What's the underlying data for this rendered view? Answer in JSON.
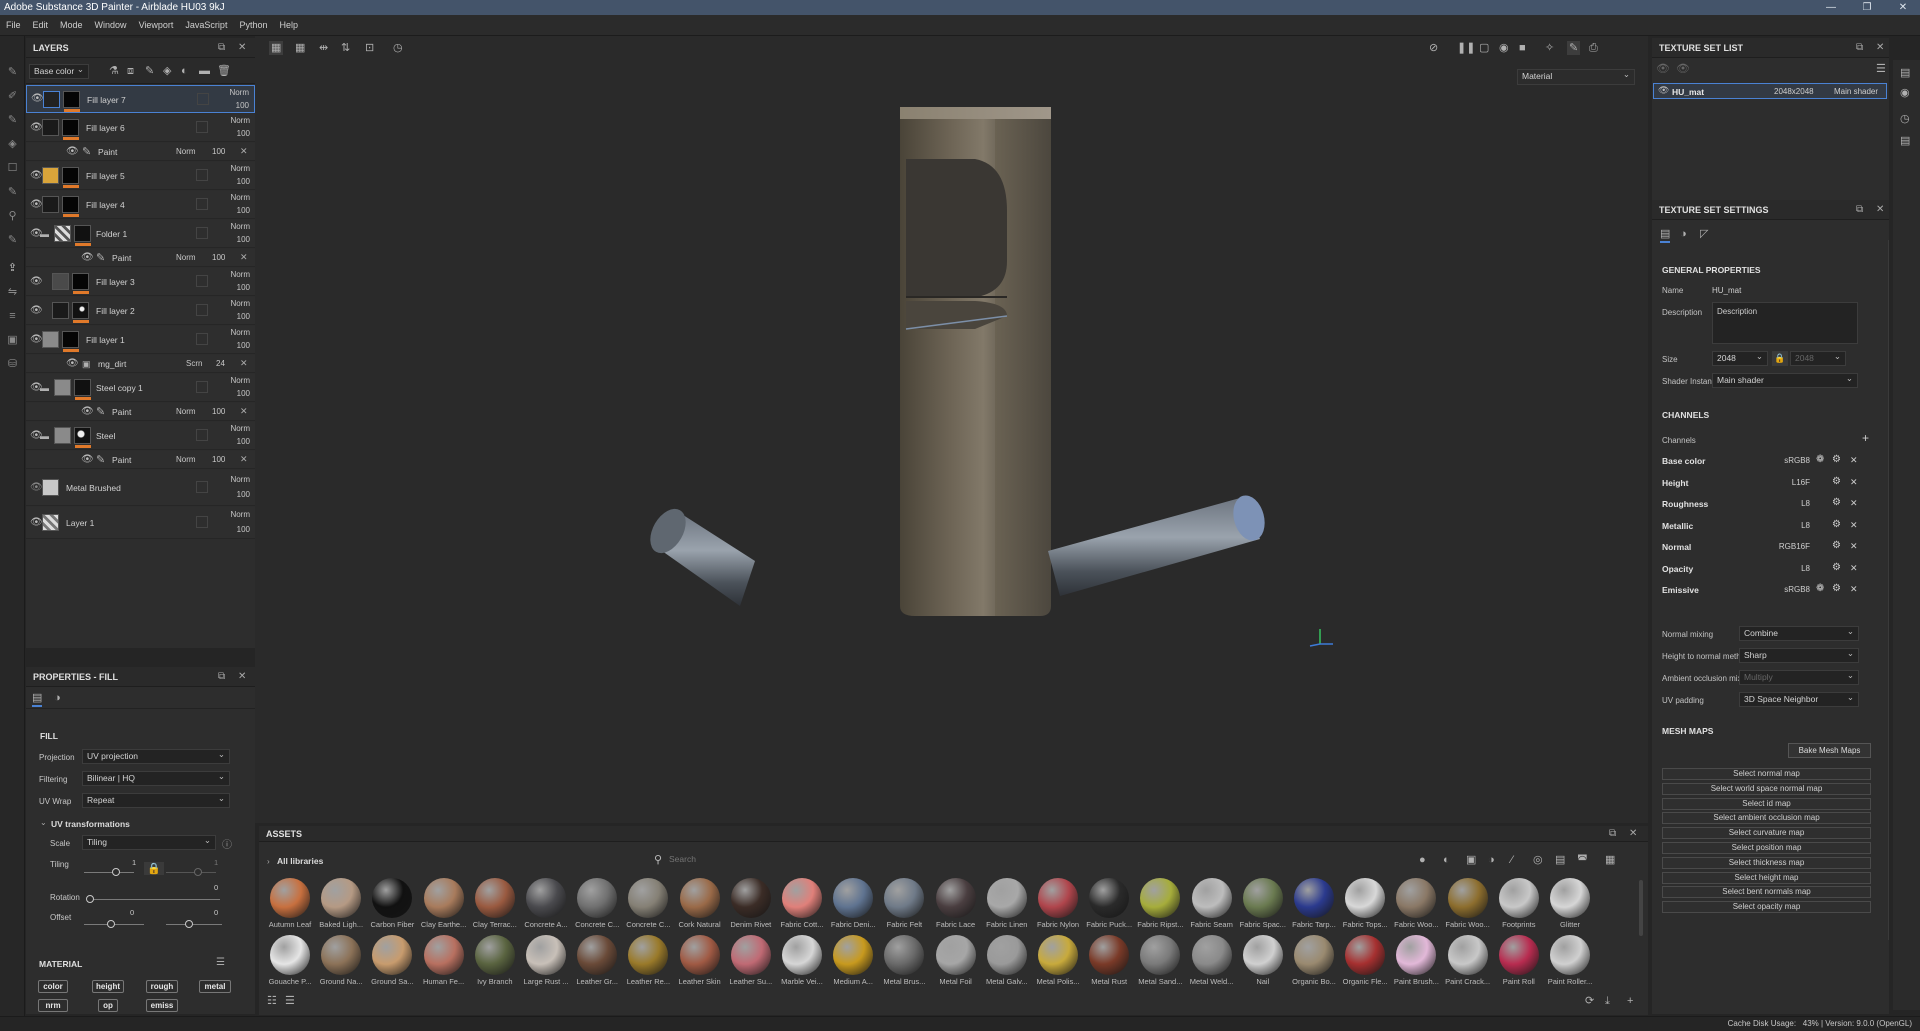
{
  "window": {
    "title": "Adobe Substance 3D Painter - Airblade HU03 9kJ"
  },
  "menu": [
    "File",
    "Edit",
    "Mode",
    "Window",
    "Viewport",
    "JavaScript",
    "Python",
    "Help"
  ],
  "layers": {
    "title": "LAYERS",
    "channel_select": "Base color",
    "rows": [
      {
        "name": "Fill layer 7",
        "blend": "Norm",
        "opacity": "100"
      },
      {
        "name": "Fill layer 6",
        "blend": "Norm",
        "opacity": "100"
      },
      {
        "name": "Paint",
        "blend": "Norm",
        "opacity": "100"
      },
      {
        "name": "Fill layer 5",
        "blend": "Norm",
        "opacity": "100"
      },
      {
        "name": "Fill layer 4",
        "blend": "Norm",
        "opacity": "100"
      },
      {
        "name": "Folder 1",
        "blend": "Norm",
        "opacity": "100"
      },
      {
        "name": "Paint",
        "blend": "Norm",
        "opacity": "100"
      },
      {
        "name": "Fill layer 3",
        "blend": "Norm",
        "opacity": "100"
      },
      {
        "name": "Fill layer 2",
        "blend": "Norm",
        "opacity": "100"
      },
      {
        "name": "Fill layer 1",
        "blend": "Norm",
        "opacity": "100"
      },
      {
        "name": "mg_dirt",
        "blend": "Scrn",
        "opacity": "24"
      },
      {
        "name": "Steel copy 1",
        "blend": "Norm",
        "opacity": "100"
      },
      {
        "name": "Paint",
        "blend": "Norm",
        "opacity": "100"
      },
      {
        "name": "Steel",
        "blend": "Norm",
        "opacity": "100"
      },
      {
        "name": "Paint",
        "blend": "Norm",
        "opacity": "100"
      },
      {
        "name": "Metal Brushed",
        "blend": "Norm",
        "opacity": "100"
      },
      {
        "name": "Layer 1",
        "blend": "Norm",
        "opacity": "100"
      }
    ]
  },
  "properties": {
    "title": "PROPERTIES - FILL",
    "section": "FILL",
    "projection_label": "Projection",
    "projection": "UV projection",
    "filtering_label": "Filtering",
    "filtering": "Bilinear | HQ",
    "uvwrap_label": "UV Wrap",
    "uvwrap": "Repeat",
    "uvt_label": "UV transformations",
    "scale_label": "Scale",
    "scale": "Tiling",
    "tiling_label": "Tiling",
    "tiling_v1": "1",
    "tiling_v2": "1",
    "rotation_label": "Rotation",
    "rotation": "0",
    "offset_label": "Offset",
    "offset_v1": "0",
    "offset_v2": "0",
    "material_title": "MATERIAL",
    "channels": [
      "color",
      "height",
      "rough",
      "metal",
      "nrm",
      "op",
      "emiss"
    ]
  },
  "viewport": {
    "mode": "Material"
  },
  "texture_set_list": {
    "title": "TEXTURE SET LIST",
    "name": "HU_mat",
    "size": "2048x2048",
    "shader": "Main shader"
  },
  "texture_set_settings": {
    "title": "TEXTURE SET SETTINGS",
    "general": "GENERAL PROPERTIES",
    "name_label": "Name",
    "name": "HU_mat",
    "desc_label": "Description",
    "desc": "Description",
    "size_label": "Size",
    "size": "2048",
    "size2": "2048",
    "shader_label": "Shader Instance",
    "shader": "Main shader",
    "channels_title": "CHANNELS",
    "channels_label": "Channels",
    "channels": [
      {
        "name": "Base color",
        "fmt": "sRGB8"
      },
      {
        "name": "Height",
        "fmt": "L16F"
      },
      {
        "name": "Roughness",
        "fmt": "L8"
      },
      {
        "name": "Metallic",
        "fmt": "L8"
      },
      {
        "name": "Normal",
        "fmt": "RGB16F"
      },
      {
        "name": "Opacity",
        "fmt": "L8"
      },
      {
        "name": "Emissive",
        "fmt": "sRGB8"
      }
    ],
    "normal_mixing_label": "Normal mixing",
    "normal_mixing": "Combine",
    "htn_label": "Height to normal method",
    "htn": "Sharp",
    "ao_label": "Ambient occlusion mixing",
    "ao": "Multiply",
    "uvpad_label": "UV padding",
    "uvpad": "3D Space Neighbor",
    "mesh_maps_title": "MESH MAPS",
    "bake": "Bake Mesh Maps",
    "maps": [
      "Select normal map",
      "Select world space normal map",
      "Select id map",
      "Select ambient occlusion map",
      "Select curvature map",
      "Select position map",
      "Select thickness map",
      "Select height map",
      "Select bent normals map",
      "Select opacity map"
    ]
  },
  "assets": {
    "title": "ASSETS",
    "library": "All libraries",
    "search_placeholder": "Search",
    "row1": [
      "Autumn Leaf",
      "Baked Ligh...",
      "Carbon Fiber",
      "Clay Earthe...",
      "Clay Terrac...",
      "Concrete A...",
      "Concrete C...",
      "Concrete C...",
      "Cork Natural",
      "Denim Rivet",
      "Fabric Cott...",
      "Fabric Deni...",
      "Fabric Felt",
      "Fabric Lace",
      "Fabric Linen",
      "Fabric Nylon",
      "Fabric Puck...",
      "Fabric Ripst...",
      "Fabric Seam",
      "Fabric Spac...",
      "Fabric Tarp...",
      "Fabric Tops...",
      "Fabric Woo...",
      "Fabric Woo...",
      "Footprints",
      "Glitter"
    ],
    "row2": [
      "Gouache P...",
      "Ground Na...",
      "Ground Sa...",
      "Human Fe...",
      "Ivy Branch",
      "Large Rust ...",
      "Leather Gr...",
      "Leather Re...",
      "Leather Skin",
      "Leather Su...",
      "Marble Vei...",
      "Medium A...",
      "Metal Brus...",
      "Metal Foil",
      "Metal Galv...",
      "Metal Polis...",
      "Metal Rust",
      "Metal Sand...",
      "Metal Weld...",
      "Nail",
      "Organic Bo...",
      "Organic Fle...",
      "Paint Brush...",
      "Paint Crack...",
      "Paint Roll",
      "Paint Roller..."
    ],
    "row1_colors": [
      "#c8703f",
      "#b59a84",
      "#111111",
      "#a87b5c",
      "#9a5a40",
      "#4a4a4e",
      "#707070",
      "#858075",
      "#9a6a48",
      "#3b2c26",
      "#e0807a",
      "#5f7390",
      "#6f7a88",
      "#4a3e40",
      "#a8a8a8",
      "#b0454c",
      "#2a2a2a",
      "#a6ad3b",
      "#bdbdbd",
      "#6a7a50",
      "#2b3a8e",
      "#d8d8d8",
      "#8a7866",
      "#8d6e2e",
      "#c8c8c8",
      "#d6d6d6"
    ],
    "row2_colors": [
      "#e5e5e5",
      "#8c7258",
      "#c89c6e",
      "#b87060",
      "#5a6440",
      "#c8c0b8",
      "#6a4a38",
      "#9a7a2a",
      "#a05a44",
      "#c06a74",
      "#d6d6d6",
      "#c89a1e",
      "#6a6a6a",
      "#a6a6a6",
      "#9a9a9a",
      "#c8aa3c",
      "#7a3a28",
      "#7a7a7a",
      "#8a8a8a",
      "#d0d0d0",
      "#9a8a70",
      "#a63030",
      "#e2b8d8",
      "#c8c8c8",
      "#b82c50",
      "#d0d0d0"
    ]
  },
  "status": {
    "text": "Cache Disk Usage:   43% | Version: 9.0.0 (OpenGL)"
  }
}
